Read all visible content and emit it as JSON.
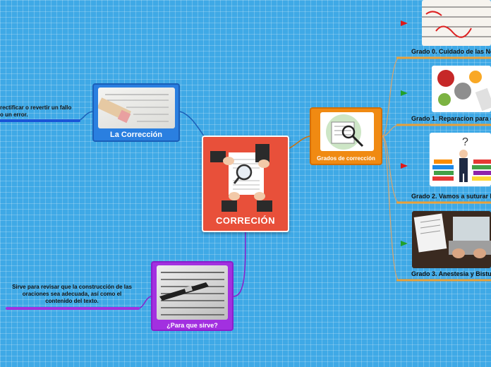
{
  "central": {
    "title": "CORRECIÓN"
  },
  "topics": {
    "correccion": {
      "label": "La Corrección",
      "note": "rectificar o revertir un fallo o un error."
    },
    "sirve": {
      "label": "¿Para que sirve?",
      "note": "Sirve para revisar que la construcción de las oraciones sea adecuada, así como el contenido del texto."
    },
    "grados": {
      "label": "Grados de corrección",
      "items": [
        {
          "label": "Grado 0. Cuidado de las No",
          "flag_color": "#e01818"
        },
        {
          "label": "Grado 1. Reparacion para c",
          "flag_color": "#22a02a"
        },
        {
          "label": "Grado 2. Vamos a suturar l",
          "flag_color": "#e01818"
        },
        {
          "label": "Grado 3. Anestesia y Bistu",
          "flag_color": "#22a02a"
        }
      ]
    }
  },
  "colors": {
    "central": "#e8503a",
    "blue_topic": "#2a7fe0",
    "purple_topic": "#a230e0",
    "orange_topic": "#f08a12"
  }
}
